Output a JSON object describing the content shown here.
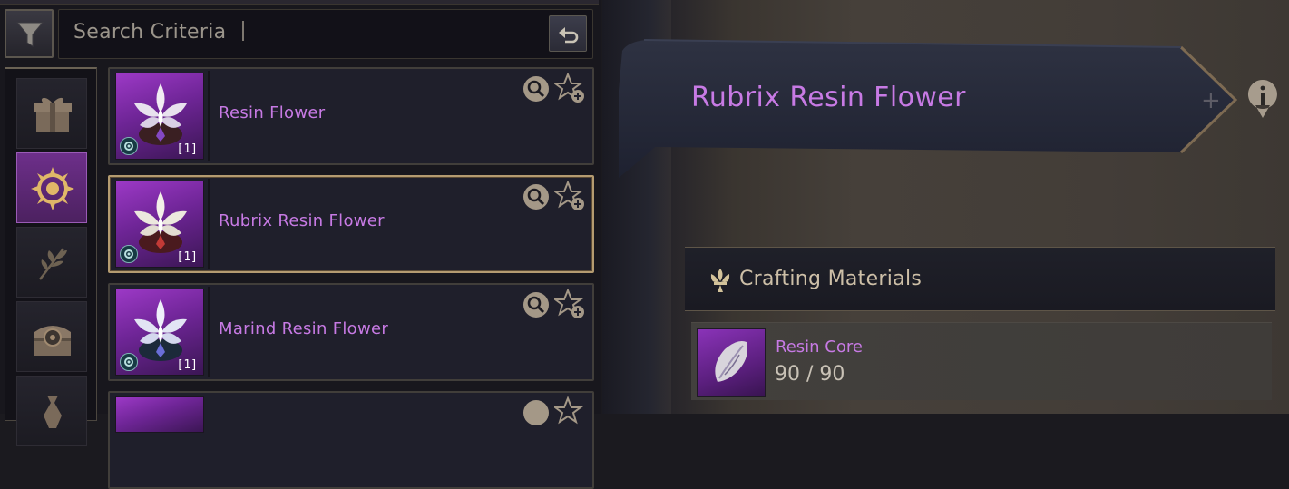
{
  "search": {
    "placeholder": "Search Criteria"
  },
  "categories": [
    {
      "icon": "gift-box-icon",
      "active": false
    },
    {
      "icon": "compass-emblem-icon",
      "active": true
    },
    {
      "icon": "leaf-icon",
      "active": false
    },
    {
      "icon": "treasure-chest-icon",
      "active": false
    },
    {
      "icon": "pouch-icon",
      "active": false
    }
  ],
  "items": [
    {
      "name": "Resin Flower",
      "count": "[1]",
      "selected": false,
      "tint": "purple"
    },
    {
      "name": "Rubrix Resin Flower",
      "count": "[1]",
      "selected": true,
      "tint": "red"
    },
    {
      "name": "Marind Resin Flower",
      "count": "[1]",
      "selected": false,
      "tint": "blue"
    }
  ],
  "detail": {
    "title": "Rubrix Resin Flower",
    "materials_header": "Crafting Materials",
    "materials": [
      {
        "name": "Resin Core",
        "quantity": "90 / 90"
      }
    ]
  },
  "colors": {
    "item_name": "#c77ae4",
    "selected_border": "#b49b70",
    "active_category": "#6d2f8a"
  }
}
